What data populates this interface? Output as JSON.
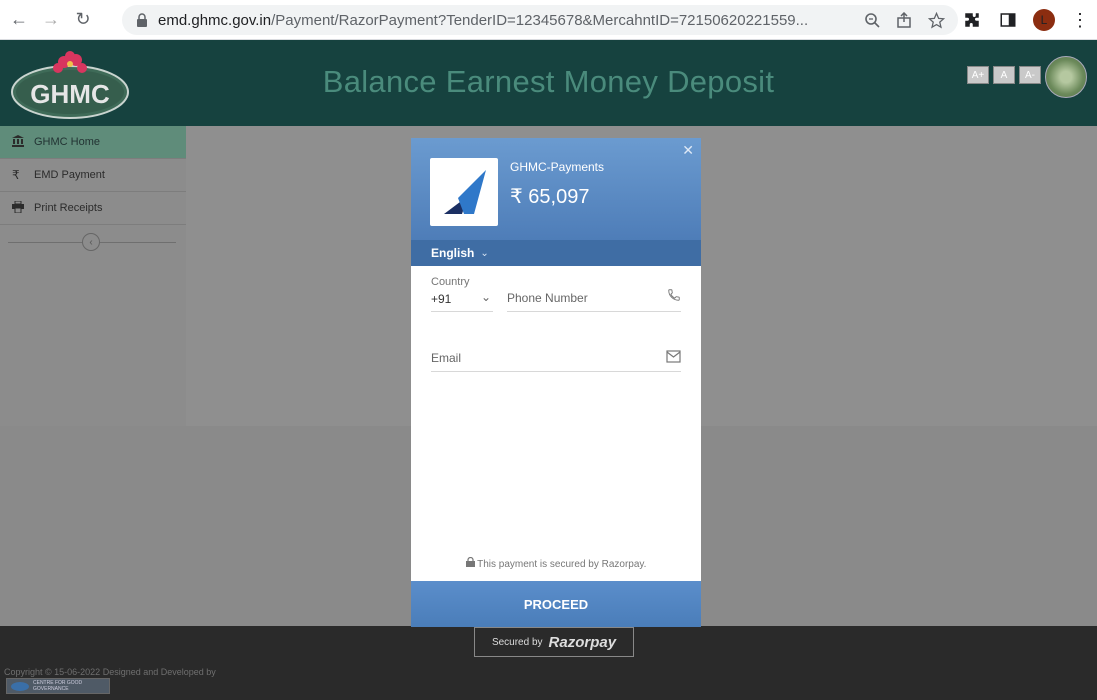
{
  "browser": {
    "url_domain": "emd.ghmc.gov.in",
    "url_path": "/Payment/RazorPayment?TenderID=12345678&MercahntID=72150620221559...",
    "avatar_letter": "L"
  },
  "header": {
    "logo_text": "GHMC",
    "title": "Balance Earnest Money Deposit",
    "font_buttons": [
      "A+",
      "A",
      "A-"
    ]
  },
  "sidebar": {
    "items": [
      {
        "label": "GHMC Home",
        "icon": "bank-icon"
      },
      {
        "label": "EMD Payment",
        "icon": "rupee-icon"
      },
      {
        "label": "Print Receipts",
        "icon": "printer-icon"
      }
    ]
  },
  "modal": {
    "merchant_name": "GHMC-Payments",
    "amount": "₹ 65,097",
    "language": "English",
    "country_label": "Country",
    "country_code": "+91",
    "phone_placeholder": "Phone Number",
    "email_placeholder": "Email",
    "secure_note": "This payment is secured by Razorpay.",
    "proceed_label": "PROCEED"
  },
  "footer": {
    "copyright": "Copyright © 15-06-2022 Designed and Developed by",
    "cgg_text": "CENTRE FOR GOOD GOVERNANCE",
    "secured_by": "Secured by",
    "razorpay": "Razorpay"
  },
  "colors": {
    "header_bg": "#16423f",
    "modal_accent": "#4e7db8",
    "overlay_gray": "#8a8a8a"
  }
}
